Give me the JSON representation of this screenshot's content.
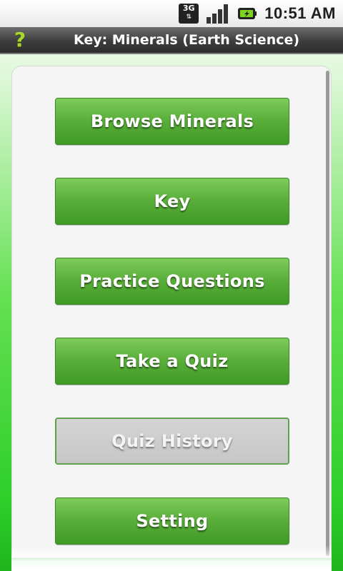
{
  "status_bar": {
    "network_label": "3G",
    "network_icon": "3g-data-icon",
    "signal_icon": "signal-strength-icon",
    "battery_icon": "battery-charging-icon",
    "time": "10:51 AM"
  },
  "title_bar": {
    "help_icon": "help-question-icon",
    "help_glyph": "?",
    "title": "Key: Minerals (Earth Science)"
  },
  "menu": {
    "buttons": [
      {
        "label": "Browse Minerals",
        "enabled": true
      },
      {
        "label": "Key",
        "enabled": true
      },
      {
        "label": "Practice Questions",
        "enabled": true
      },
      {
        "label": "Take a Quiz",
        "enabled": true
      },
      {
        "label": "Quiz History",
        "enabled": false
      },
      {
        "label": "Setting",
        "enabled": true
      }
    ]
  },
  "colors": {
    "button_green": "#5cb03c",
    "button_disabled": "#cccccc",
    "background_green": "#2fcf2a",
    "help_icon": "#a8d830"
  }
}
